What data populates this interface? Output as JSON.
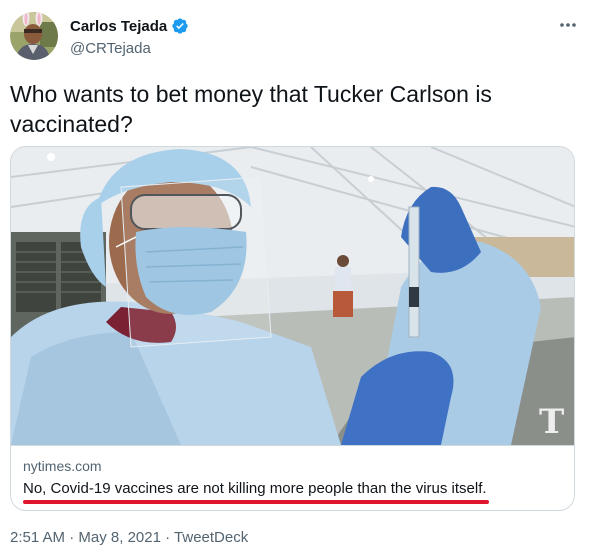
{
  "author": {
    "display_name": "Carlos Tejada",
    "handle": "@CRTejada",
    "verified": true
  },
  "tweet": {
    "text": "Who wants to bet money that Tucker Carlson is vaccinated?"
  },
  "link_card": {
    "domain": "nytimes.com",
    "title": "No, Covid-19 vaccines are not killing more people than the virus itself.",
    "watermark": "T"
  },
  "meta": {
    "time": "2:51 AM",
    "separator": "·",
    "date": "May 8, 2021",
    "source": "TweetDeck"
  },
  "colors": {
    "verified_blue": "#1d9bf0",
    "underline_red": "#e0142a",
    "secondary_text": "#536471"
  },
  "icons": {
    "verified": "verified-badge-icon",
    "more": "more-options-icon"
  }
}
